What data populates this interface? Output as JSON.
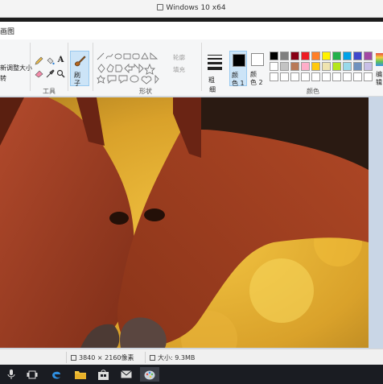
{
  "vm_window": {
    "title": "Windows 10 x64"
  },
  "app": {
    "title_fragment": "画图"
  },
  "ribbon": {
    "image_group": {
      "resize_label": "新调整大小",
      "rotate_fragment": "转"
    },
    "tools_group": {
      "label": "工具",
      "text_tool": "A"
    },
    "brush_button": {
      "label_line1": "刷",
      "label_line2": "子"
    },
    "shapes_group": {
      "label": "形状",
      "outline_label": "轮廓",
      "fill_label": "填充"
    },
    "size_button": {
      "label_line1": "粗",
      "label_line2": "细"
    },
    "color1_button": {
      "label_line1": "颜",
      "label_line2": "色 1",
      "color": "#000000"
    },
    "color2_button": {
      "label_line1": "颜",
      "label_line2": "色 2",
      "color": "#ffffff"
    },
    "colors_group": {
      "label": "颜色",
      "palette_row1": [
        "#000000",
        "#7f7f7f",
        "#880015",
        "#ed1c24",
        "#ff7f27",
        "#fff200",
        "#22b14c",
        "#00a2e8",
        "#3f48cc",
        "#a349a4"
      ],
      "palette_row2": [
        "#ffffff",
        "#c3c3c3",
        "#b97a57",
        "#ffaec9",
        "#ffc90e",
        "#efe4b0",
        "#b5e61d",
        "#99d9ea",
        "#7092be",
        "#c8bfe7"
      ],
      "palette_row3": [
        "#ffffff",
        "#ffffff",
        "#ffffff",
        "#ffffff",
        "#ffffff",
        "#ffffff",
        "#ffffff",
        "#ffffff",
        "#ffffff",
        "#ffffff"
      ]
    },
    "edit_colors_button": {
      "label_line1": "编",
      "label_line2": "辑"
    }
  },
  "status_bar": {
    "dimensions": "3840 × 2160像素",
    "size": "大小: 9.3MB"
  },
  "accent": "#cce4f7",
  "taskbar": {
    "icons": [
      "microphone-icon",
      "task-view-icon",
      "edge-icon",
      "file-explorer-icon",
      "store-icon",
      "mail-icon",
      "paint-icon"
    ]
  }
}
